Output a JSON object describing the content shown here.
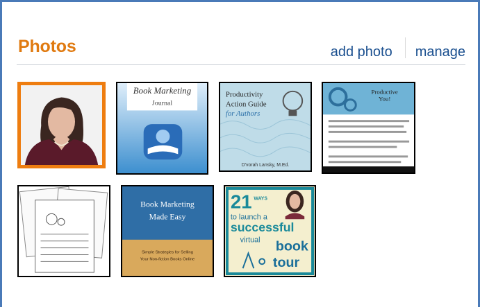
{
  "header": {
    "title": "Photos",
    "add_photo_label": "add photo",
    "manage_label": "manage"
  },
  "photos": [
    {
      "name": "author-portrait",
      "selected": true
    },
    {
      "name": "book-marketing-journal",
      "texts": [
        "Book Marketing",
        "Journal"
      ]
    },
    {
      "name": "productivity-action-guide",
      "texts": [
        "Productivity",
        "Action Guide",
        "for Authors",
        "D'vorah Lansky, M.Ed."
      ]
    },
    {
      "name": "productive-you",
      "texts": [
        "Productive",
        "You!"
      ]
    },
    {
      "name": "worksheet-pages"
    },
    {
      "name": "book-marketing-made-easy",
      "texts": [
        "Book Marketing",
        "Made Easy",
        "Simple Strategies for Selling",
        "Your Non-fiction Books Online"
      ]
    },
    {
      "name": "virtual-book-tour",
      "texts": [
        "21",
        "WAYS",
        "to launch a",
        "successful",
        "virtual",
        "book",
        "tour"
      ]
    }
  ],
  "colors": {
    "accent": "#e07a10",
    "link": "#1a4f8f",
    "frame": "#4a7ab8"
  }
}
